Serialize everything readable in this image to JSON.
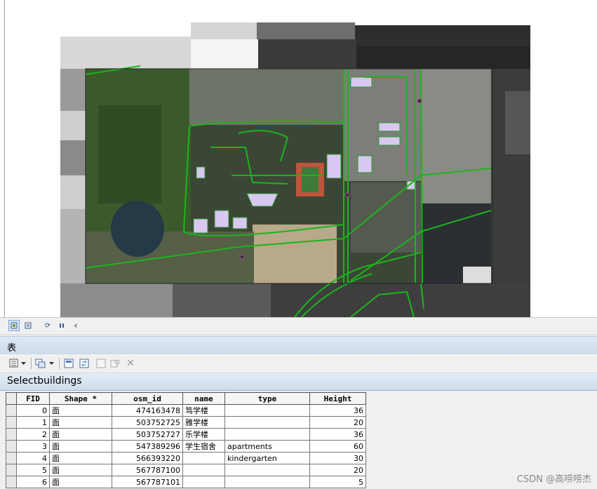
{
  "panel_title": "表",
  "table_name": "Selectbuildings",
  "map_toolbar": {
    "buttons": [
      {
        "name": "layout-view-icon",
        "active": true
      },
      {
        "name": "data-view-icon",
        "active": false
      },
      {
        "name": "refresh-icon",
        "active": false
      },
      {
        "name": "pause-icon",
        "active": false
      },
      {
        "name": "chevron-left-icon",
        "active": false
      }
    ]
  },
  "table_toolbar": {
    "buttons": [
      {
        "name": "table-options-icon",
        "has_dropdown": true
      },
      {
        "name": "related-tables-icon",
        "has_dropdown": true
      },
      {
        "name": "select-by-attributes-icon",
        "has_dropdown": false
      },
      {
        "name": "switch-selection-icon",
        "has_dropdown": false
      },
      {
        "name": "clear-selection-icon",
        "has_dropdown": false
      },
      {
        "name": "zoom-to-selected-icon",
        "has_dropdown": false
      },
      {
        "name": "delete-selected-icon",
        "has_dropdown": false
      }
    ]
  },
  "columns": [
    "FID",
    "Shape *",
    "osm_id",
    "name",
    "type",
    "Height"
  ],
  "rows": [
    {
      "fid": "0",
      "shape": "面",
      "osm_id": "474163478",
      "name": "笃学楼",
      "type": "",
      "height": "36"
    },
    {
      "fid": "1",
      "shape": "面",
      "osm_id": "503752725",
      "name": "雅学楼",
      "type": "",
      "height": "20"
    },
    {
      "fid": "2",
      "shape": "面",
      "osm_id": "503752727",
      "name": "乐学楼",
      "type": "",
      "height": "36"
    },
    {
      "fid": "3",
      "shape": "面",
      "osm_id": "547389296",
      "name": "学生宿舍",
      "type": "apartments",
      "height": "60"
    },
    {
      "fid": "4",
      "shape": "面",
      "osm_id": "566393220",
      "name": "",
      "type": "kindergarten",
      "height": "30"
    },
    {
      "fid": "5",
      "shape": "面",
      "osm_id": "567787100",
      "name": "",
      "type": "",
      "height": "20"
    },
    {
      "fid": "6",
      "shape": "面",
      "osm_id": "567787101",
      "name": "",
      "type": "",
      "height": "5"
    }
  ],
  "watermark": "CSDN @高唠唠杰",
  "colors": {
    "road_green": "#1bb51b",
    "building_fill": "#d8c8f0",
    "imagery_dark": "#2f3a2a"
  }
}
